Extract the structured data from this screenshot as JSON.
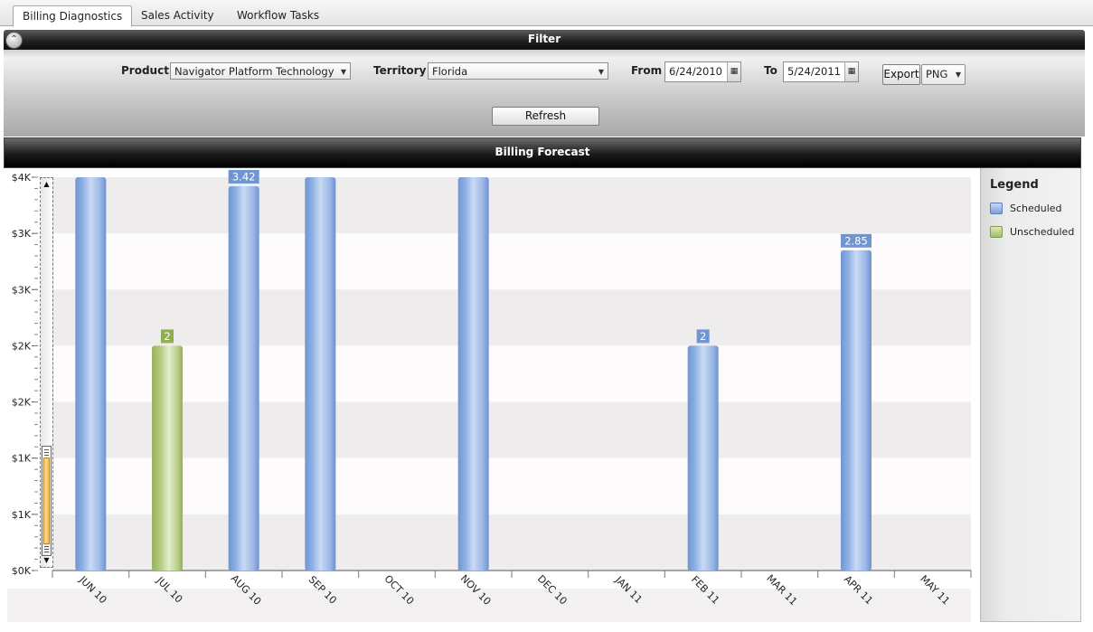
{
  "tabs": [
    {
      "label": "Billing Diagnostics",
      "active": true
    },
    {
      "label": "Sales Activity",
      "active": false
    },
    {
      "label": "Workflow Tasks",
      "active": false
    }
  ],
  "filter": {
    "title": "Filter",
    "product_label": "Product",
    "product_value": "Navigator Platform Technology",
    "territory_label": "Territory",
    "territory_value": "Florida",
    "from_label": "From",
    "from_value": "6/24/2010",
    "to_label": "To",
    "to_value": "5/24/2011",
    "export_label": "Export",
    "export_format": "PNG",
    "refresh_label": "Refresh"
  },
  "forecast": {
    "title": "Billing Forecast"
  },
  "legend": {
    "title": "Legend",
    "items": [
      {
        "label": "Scheduled",
        "color": "#7aa0d8"
      },
      {
        "label": "Unscheduled",
        "color": "#a3bd6b"
      }
    ]
  },
  "chart_data": {
    "type": "bar",
    "categories": [
      "JUN 10",
      "JUL 10",
      "AUG 10",
      "SEP 10",
      "OCT 10",
      "NOV 10",
      "DEC 10",
      "JAN 11",
      "FEB 11",
      "MAR 11",
      "APR 11",
      "MAY 11"
    ],
    "y_tick_labels": [
      "$0K",
      "$1K",
      "$1K",
      "$2K",
      "$2K",
      "$3K",
      "$3K",
      "$4K"
    ],
    "ylim": [
      0,
      3.5
    ],
    "grid": true,
    "legend_position": "right",
    "series": [
      {
        "name": "Scheduled",
        "color": "#7aa0d8",
        "values": [
          3.5,
          null,
          3.42,
          3.5,
          null,
          3.5,
          null,
          null,
          2,
          null,
          2.85,
          null
        ],
        "labels": [
          null,
          null,
          "3.42",
          null,
          null,
          null,
          null,
          null,
          "2",
          null,
          "2.85",
          null
        ]
      },
      {
        "name": "Unscheduled",
        "color": "#a3bd6b",
        "values": [
          null,
          2,
          null,
          null,
          null,
          null,
          null,
          null,
          null,
          null,
          null,
          null
        ],
        "labels": [
          null,
          "2",
          null,
          null,
          null,
          null,
          null,
          null,
          null,
          null,
          null,
          null
        ]
      }
    ]
  }
}
